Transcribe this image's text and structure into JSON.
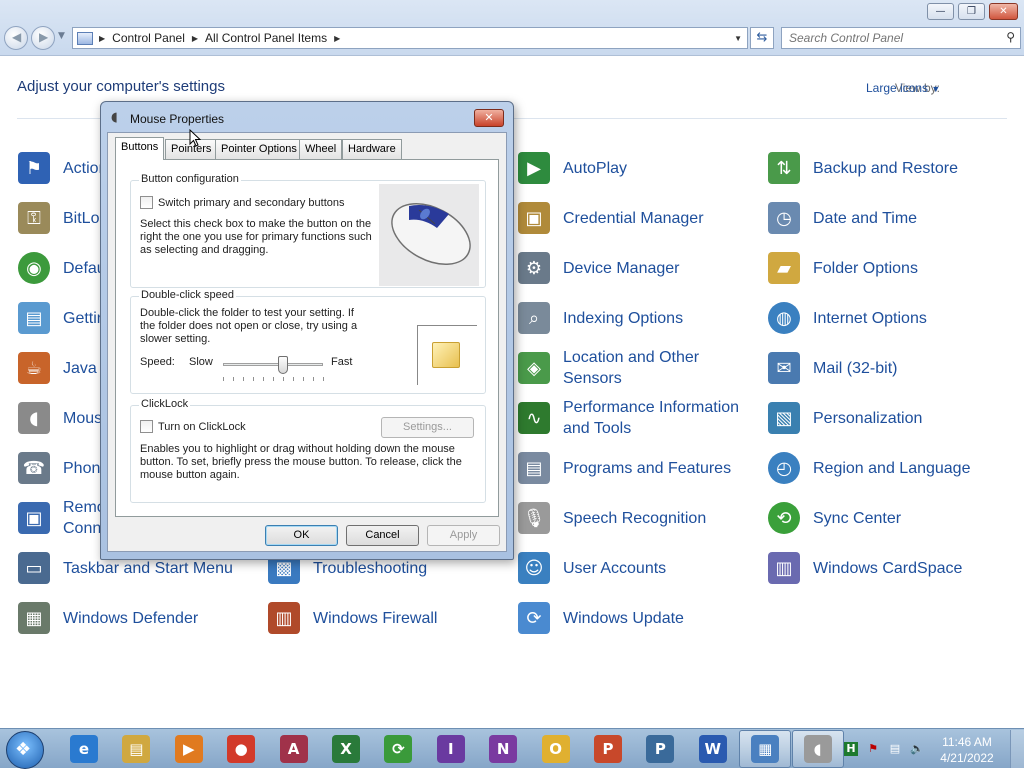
{
  "address": {
    "crumbs": [
      "Control Panel",
      "All Control Panel Items"
    ]
  },
  "search": {
    "placeholder": "Search Control Panel"
  },
  "header": {
    "title": "Adjust your computer's settings",
    "view_by_label": "View by:",
    "view_by_value": "Large icons"
  },
  "items": [
    {
      "label": "Action Center",
      "icon": "flag-icon",
      "color": "#2f62b4"
    },
    {
      "label": "BitLocker Drive Encryption",
      "icon": "key-icon",
      "color": "#9a8a5a"
    },
    {
      "label": "Default Programs",
      "icon": "default-programs-icon",
      "color": "#3c9a3c"
    },
    {
      "label": "Getting Started",
      "icon": "getting-started-icon",
      "color": "#5a9ad0"
    },
    {
      "label": "Java (32-bit)",
      "icon": "java-icon",
      "color": "#c8642a"
    },
    {
      "label": "Mouse",
      "icon": "mouse-icon",
      "color": "#8a8a8a"
    },
    {
      "label": "Phone and Modem",
      "icon": "phone-icon",
      "color": "#6a7a8a"
    },
    {
      "label": "RemoteApp and Desktop Connections",
      "icon": "remote-icon",
      "color": "#3a6ab0"
    },
    {
      "label": "Taskbar and Start Menu",
      "icon": "taskbar-icon",
      "color": "#4a6a90"
    },
    {
      "label": "Troubleshooting",
      "icon": "troubleshooting-icon",
      "color": "#3a7ac0"
    },
    {
      "label": "AutoPlay",
      "icon": "autoplay-icon",
      "color": "#2e8b3e"
    },
    {
      "label": "Credential Manager",
      "icon": "credential-icon",
      "color": "#b08a3a"
    },
    {
      "label": "Device Manager",
      "icon": "device-manager-icon",
      "color": "#6a7a8a"
    },
    {
      "label": "Indexing Options",
      "icon": "indexing-icon",
      "color": "#7a8a9a"
    },
    {
      "label": "Location and Other Sensors",
      "icon": "sensors-icon",
      "color": "#4a9a4a"
    },
    {
      "label": "Performance Information and Tools",
      "icon": "performance-icon",
      "color": "#2e7a2e"
    },
    {
      "label": "Programs and Features",
      "icon": "programs-icon",
      "color": "#7a8aa0"
    },
    {
      "label": "Speech Recognition",
      "icon": "microphone-icon",
      "color": "#9a9a9a"
    },
    {
      "label": "User Accounts",
      "icon": "users-icon",
      "color": "#3a80c0"
    },
    {
      "label": "Windows CardSpace",
      "icon": "cardspace-icon",
      "color": "#6a6ab0"
    },
    {
      "label": "Backup and Restore",
      "icon": "backup-icon",
      "color": "#4a9a4a"
    },
    {
      "label": "Date and Time",
      "icon": "clock-icon",
      "color": "#6a8ab0"
    },
    {
      "label": "Folder Options",
      "icon": "folder-icon",
      "color": "#d0a840"
    },
    {
      "label": "Internet Options",
      "icon": "globe-icon",
      "color": "#3a80c0"
    },
    {
      "label": "Mail (32-bit)",
      "icon": "mail-icon",
      "color": "#4a7ab0"
    },
    {
      "label": "Personalization",
      "icon": "personalization-icon",
      "color": "#3a80b0"
    },
    {
      "label": "Region and Language",
      "icon": "globe-clock-icon",
      "color": "#3a80c0"
    },
    {
      "label": "Sync Center",
      "icon": "sync-icon",
      "color": "#3aa03a"
    },
    {
      "label": "Windows Defender",
      "icon": "defender-icon",
      "color": "#6a7a6a"
    },
    {
      "label": "Windows Firewall",
      "icon": "firewall-icon",
      "color": "#b04a2a"
    },
    {
      "label": "Windows Update",
      "icon": "update-icon",
      "color": "#4a8ad0"
    }
  ],
  "dialog": {
    "title": "Mouse Properties",
    "tabs": [
      "Buttons",
      "Pointers",
      "Pointer Options",
      "Wheel",
      "Hardware"
    ],
    "active_tab": "Buttons",
    "button_config": {
      "title": "Button configuration",
      "checkbox": "Switch primary and secondary buttons",
      "checked": false,
      "desc": "Select this check box to make the button on the right the one you use for primary functions such as selecting and dragging."
    },
    "double_click": {
      "title": "Double-click speed",
      "desc": "Double-click the folder to test your setting. If the folder does not open or close, try using a slower setting.",
      "speed_label": "Speed:",
      "slow": "Slow",
      "fast": "Fast",
      "value": 0.6
    },
    "clicklock": {
      "title": "ClickLock",
      "checkbox": "Turn on ClickLock",
      "checked": false,
      "settings": "Settings...",
      "desc": "Enables you to highlight or drag without holding down the mouse button. To set, briefly press the mouse button. To release, click the mouse button again."
    },
    "ok": "OK",
    "cancel": "Cancel",
    "apply": "Apply"
  },
  "taskbar": {
    "apps": [
      {
        "name": "internet-explorer-icon",
        "glyph": "e",
        "color": "#2a7ad0"
      },
      {
        "name": "windows-explorer-icon",
        "glyph": "▤",
        "color": "#d0a840"
      },
      {
        "name": "media-player-icon",
        "glyph": "▶",
        "color": "#e07a20"
      },
      {
        "name": "chrome-icon",
        "glyph": "●",
        "color": "#d23a2a"
      },
      {
        "name": "access-icon",
        "glyph": "A",
        "color": "#a0324a"
      },
      {
        "name": "excel-icon",
        "glyph": "X",
        "color": "#2a7a3a"
      },
      {
        "name": "sync-app-icon",
        "glyph": "⟳",
        "color": "#3a9a3a"
      },
      {
        "name": "infopath-icon",
        "glyph": "I",
        "color": "#6a3aa0"
      },
      {
        "name": "onenote-icon",
        "glyph": "N",
        "color": "#7a3aa0"
      },
      {
        "name": "outlook-icon",
        "glyph": "O",
        "color": "#e0b030"
      },
      {
        "name": "powerpoint-icon",
        "glyph": "P",
        "color": "#c8482a"
      },
      {
        "name": "publisher-icon",
        "glyph": "P",
        "color": "#3a6a9a"
      },
      {
        "name": "word-icon",
        "glyph": "W",
        "color": "#2a5ab0"
      },
      {
        "name": "control-panel-icon",
        "glyph": "▦",
        "color": "#4a80c0"
      },
      {
        "name": "mouse-app-icon",
        "glyph": "◖",
        "color": "#9a9a9a"
      }
    ],
    "time": "11:46 AM",
    "date": "4/21/2022"
  }
}
